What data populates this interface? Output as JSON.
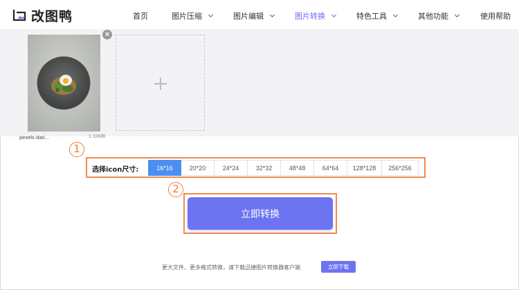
{
  "app": {
    "logo_text": "改图鸭"
  },
  "nav": {
    "items": [
      {
        "label": "首页",
        "dropdown": false,
        "active": false
      },
      {
        "label": "图片压缩",
        "dropdown": true,
        "active": false
      },
      {
        "label": "图片编辑",
        "dropdown": true,
        "active": false
      },
      {
        "label": "图片转换",
        "dropdown": true,
        "active": true
      },
      {
        "label": "特色工具",
        "dropdown": true,
        "active": false
      },
      {
        "label": "其他功能",
        "dropdown": true,
        "active": false
      },
      {
        "label": "使用帮助",
        "dropdown": false,
        "active": false
      }
    ]
  },
  "upload": {
    "file": {
      "name": "pexels-dari...",
      "size": "1.10MB"
    },
    "close_glyph": "×",
    "add_icon": "plus-icon"
  },
  "annotations": {
    "step1": "1",
    "step2": "2"
  },
  "size_selector": {
    "label": "选择icon尺寸:",
    "options": [
      "16*16",
      "20*20",
      "24*24",
      "32*32",
      "48*48",
      "64*64",
      "128*128",
      "256*256"
    ],
    "selected": "16*16"
  },
  "convert": {
    "label": "立即转换"
  },
  "footer": {
    "note": "更大文件、更多格式转换，请下载迅捷图片转换器客户端",
    "download_label": "立即下载"
  },
  "colors": {
    "accent": "#6c74f2",
    "nav_active": "#6a6ef5",
    "selected_option": "#4b8ff2",
    "annotation": "#f07a3a",
    "workspace_bg": "#f3f3f6"
  }
}
